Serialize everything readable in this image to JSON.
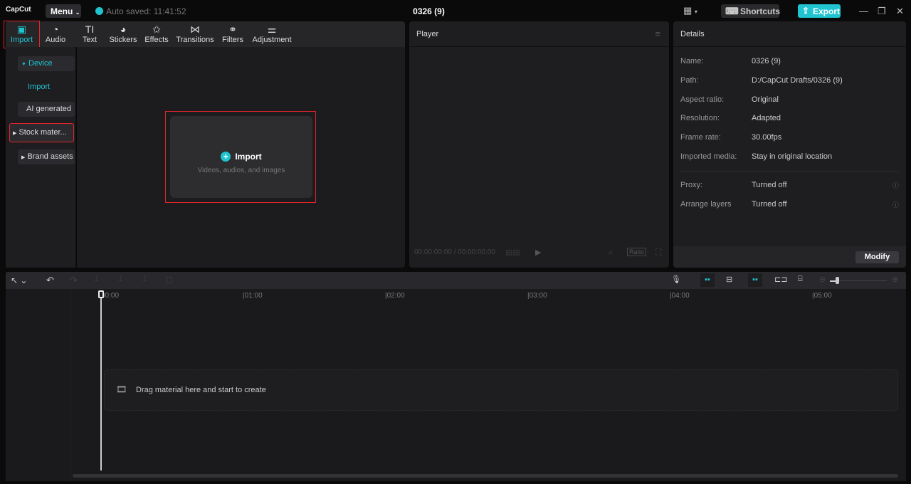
{
  "app": {
    "logo": "CapCut",
    "menu": "Menu",
    "auto_saved": "Auto saved: 11:41:52",
    "title": "0326 (9)",
    "shortcuts": "Shortcuts",
    "export": "Export"
  },
  "tabs": [
    {
      "label": "Import",
      "icon": "▣"
    },
    {
      "label": "Audio",
      "icon": "◔"
    },
    {
      "label": "Text",
      "icon": "TI"
    },
    {
      "label": "Stickers",
      "icon": "◕"
    },
    {
      "label": "Effects",
      "icon": "✩"
    },
    {
      "label": "Transitions",
      "icon": "⋈"
    },
    {
      "label": "Filters",
      "icon": "⚭"
    },
    {
      "label": "Adjustment",
      "icon": "⚌"
    }
  ],
  "sidebar": {
    "device": "Device",
    "import": "Import",
    "ai": "AI generated",
    "stock": "Stock mater...",
    "brand": "Brand assets"
  },
  "import_box": {
    "label": "Import",
    "sub": "Videos, audios, and images"
  },
  "player": {
    "title": "Player",
    "time": "00:00:00:00 / 00:00:00:00",
    "ratio": "Ratio"
  },
  "details": {
    "title": "Details",
    "rows": [
      {
        "label": "Name:",
        "value": "0326 (9)"
      },
      {
        "label": "Path:",
        "value": "D:/CapCut Drafts/0326 (9)"
      },
      {
        "label": "Aspect ratio:",
        "value": "Original"
      },
      {
        "label": "Resolution:",
        "value": "Adapted"
      },
      {
        "label": "Frame rate:",
        "value": "30.00fps"
      },
      {
        "label": "Imported media:",
        "value": "Stay in original location"
      }
    ],
    "proxy": {
      "label": "Proxy:",
      "value": "Turned off"
    },
    "arrange": {
      "label": "Arrange layers",
      "value": "Turned off"
    },
    "modify": "Modify"
  },
  "timeline": {
    "ticks": [
      "00:00",
      "01:00",
      "02:00",
      "03:00",
      "04:00",
      "05:00"
    ],
    "drop": "Drag material here and start to create",
    "zoom_level": 0.1
  }
}
